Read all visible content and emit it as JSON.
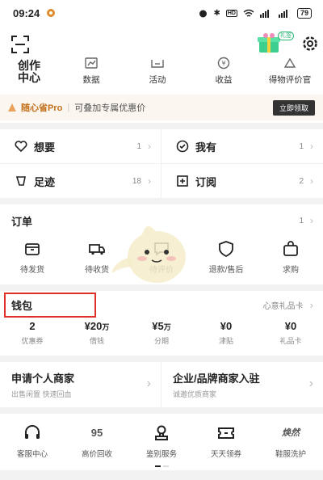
{
  "status": {
    "time": "09:24",
    "battery": "79"
  },
  "header": {
    "gift_badge": "礼签",
    "creator_label": "创作\n中心",
    "nav": [
      {
        "label": "数据",
        "icon": "chart-icon"
      },
      {
        "label": "活动",
        "icon": "activity-icon"
      },
      {
        "label": "收益",
        "icon": "coin-icon"
      },
      {
        "label": "得物评价官",
        "icon": "review-icon"
      }
    ]
  },
  "promo": {
    "brand": "随心省Pro",
    "desc": "可叠加专属优惠价",
    "button": "立即领取"
  },
  "quick": {
    "items": [
      {
        "label": "想要",
        "count": "1"
      },
      {
        "label": "我有",
        "count": "1"
      },
      {
        "label": "足迹",
        "count": "18"
      },
      {
        "label": "订阅",
        "count": "2"
      }
    ]
  },
  "orders": {
    "title": "订单",
    "count": "1",
    "items": [
      {
        "label": "待发货"
      },
      {
        "label": "待收货"
      },
      {
        "label": "待评价"
      },
      {
        "label": "退款/售后"
      },
      {
        "label": "求购"
      }
    ]
  },
  "wallet": {
    "title": "钱包",
    "gift_card_link": "心意礼品卡",
    "items": [
      {
        "value": "2",
        "unit": "",
        "label": "优惠券"
      },
      {
        "value": "¥20",
        "unit": "万",
        "label": "借钱"
      },
      {
        "value": "¥5",
        "unit": "万",
        "label": "分期"
      },
      {
        "value": "¥0",
        "unit": "",
        "label": "津贴"
      },
      {
        "value": "¥0",
        "unit": "",
        "label": "礼品卡"
      }
    ]
  },
  "merchants": [
    {
      "title": "申请个人商家",
      "sub": "出售闲置 快速回血"
    },
    {
      "title": "企业/品牌商家入驻",
      "sub": "诚邀优质商家"
    }
  ],
  "services": [
    {
      "label": "客服中心"
    },
    {
      "label": "高价回收",
      "glyph": "95"
    },
    {
      "label": "鉴别服务"
    },
    {
      "label": "天天领券"
    },
    {
      "label": "鞋服洗护",
      "glyph": "焕然"
    }
  ]
}
